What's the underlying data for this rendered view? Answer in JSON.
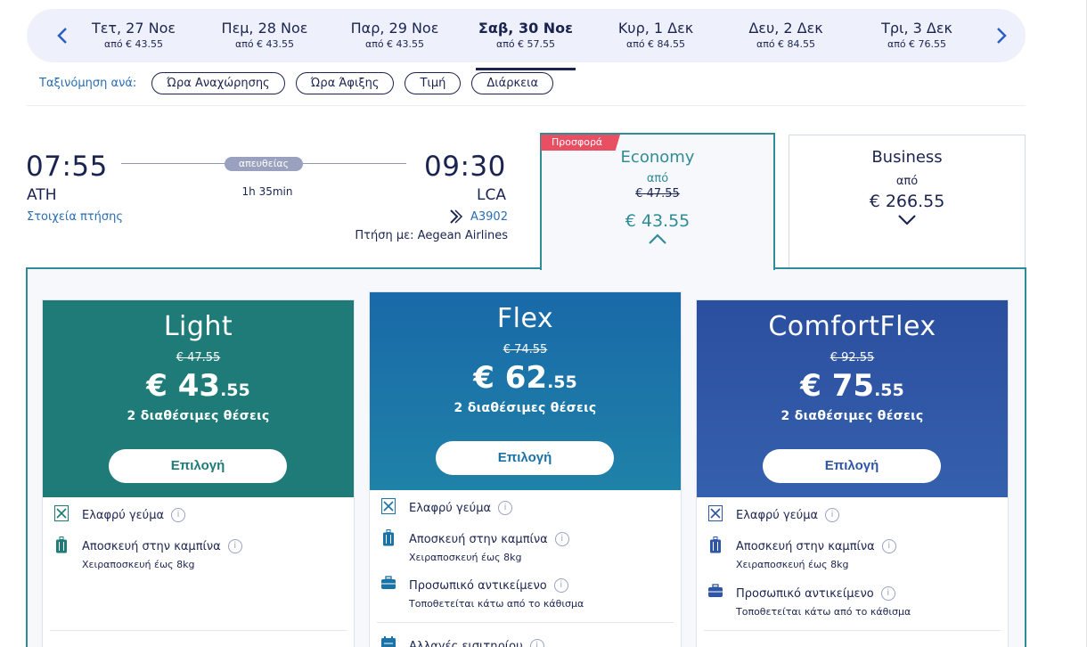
{
  "dates": [
    {
      "label": "Τετ, 27 Νοε",
      "price": "από € 43.55"
    },
    {
      "label": "Πεμ, 28 Νοε",
      "price": "από € 43.55"
    },
    {
      "label": "Παρ, 29 Νοε",
      "price": "από € 43.55"
    },
    {
      "label": "Σαβ, 30 Νοε",
      "price": "από € 57.55",
      "active": true
    },
    {
      "label": "Κυρ, 1 Δεκ",
      "price": "από € 84.55"
    },
    {
      "label": "Δευ, 2 Δεκ",
      "price": "από € 84.55"
    },
    {
      "label": "Τρι, 3 Δεκ",
      "price": "από € 76.55"
    }
  ],
  "sort": {
    "label": "Ταξινόμηση ανά:",
    "options": [
      "Ώρα Αναχώρησης",
      "Ώρα Άφιξης",
      "Τιμή",
      "Διάρκεια"
    ]
  },
  "flight": {
    "departure_time": "07:55",
    "departure_airport": "ATH",
    "arrival_time": "09:30",
    "arrival_airport": "LCA",
    "direct_label": "απευθείας",
    "duration": "1h 35min",
    "details_link": "Στοιχεία πτήσης",
    "flight_number": "A3902",
    "operated_by": "Πτήση με: Aegean Airlines"
  },
  "cabins": {
    "economy": {
      "promo": "Προσφορά",
      "title": "Economy",
      "from": "από",
      "old_price": "€ 47.55",
      "price": "€ 43.55"
    },
    "business": {
      "title": "Business",
      "from": "από",
      "price": "€ 266.55"
    }
  },
  "fares": [
    {
      "name": "Light",
      "old_price": "€ 47.55",
      "price_main": "€ 43",
      "price_cents": ".55",
      "seats": "2 διαθέσιμες θέσεις",
      "select": "Επιλογή",
      "color": "#1e7b78",
      "features": [
        {
          "icon": "meal-icon",
          "text": "Ελαφρύ γεύμα",
          "sub": ""
        },
        {
          "icon": "trolley-bag-icon",
          "text": "Αποσκευή στην καμπίνα",
          "sub": "Χειραποσκευή έως 8kg"
        }
      ]
    },
    {
      "name": "Flex",
      "old_price": "€ 74.55",
      "price_main": "€ 62",
      "price_cents": ".55",
      "seats": "2 διαθέσιμες θέσεις",
      "select": "Επιλογή",
      "color": "#1a72a6",
      "features": [
        {
          "icon": "meal-icon",
          "text": "Ελαφρύ γεύμα",
          "sub": ""
        },
        {
          "icon": "trolley-bag-icon",
          "text": "Αποσκευή στην καμπίνα",
          "sub": "Χειραποσκευή έως 8kg"
        },
        {
          "icon": "personal-item-icon",
          "text": "Προσωπικό αντικείμενο",
          "sub": "Τοποθετείται κάτω από το κάθισμα"
        },
        {
          "icon": "calendar-change-icon",
          "text": "Αλλαγές εισιτηρίου",
          "sub": ""
        }
      ]
    },
    {
      "name": "ComfortFlex",
      "old_price": "€ 92.55",
      "price_main": "€ 75",
      "price_cents": ".55",
      "seats": "2 διαθέσιμες θέσεις",
      "select": "Επιλογή",
      "color": "#2f55a6",
      "features": [
        {
          "icon": "meal-icon",
          "text": "Ελαφρύ γεύμα",
          "sub": ""
        },
        {
          "icon": "trolley-bag-icon",
          "text": "Αποσκευή στην καμπίνα",
          "sub": "Χειραποσκευή έως 8kg"
        },
        {
          "icon": "personal-item-icon",
          "text": "Προσωπικό αντικείμενο",
          "sub": "Τοποθετείται κάτω από το κάθισμα"
        }
      ]
    }
  ],
  "colors": {
    "navy": "#1b2450",
    "teal": "#2f8b96",
    "link": "#2a6db5",
    "promo": "#e94f62"
  }
}
